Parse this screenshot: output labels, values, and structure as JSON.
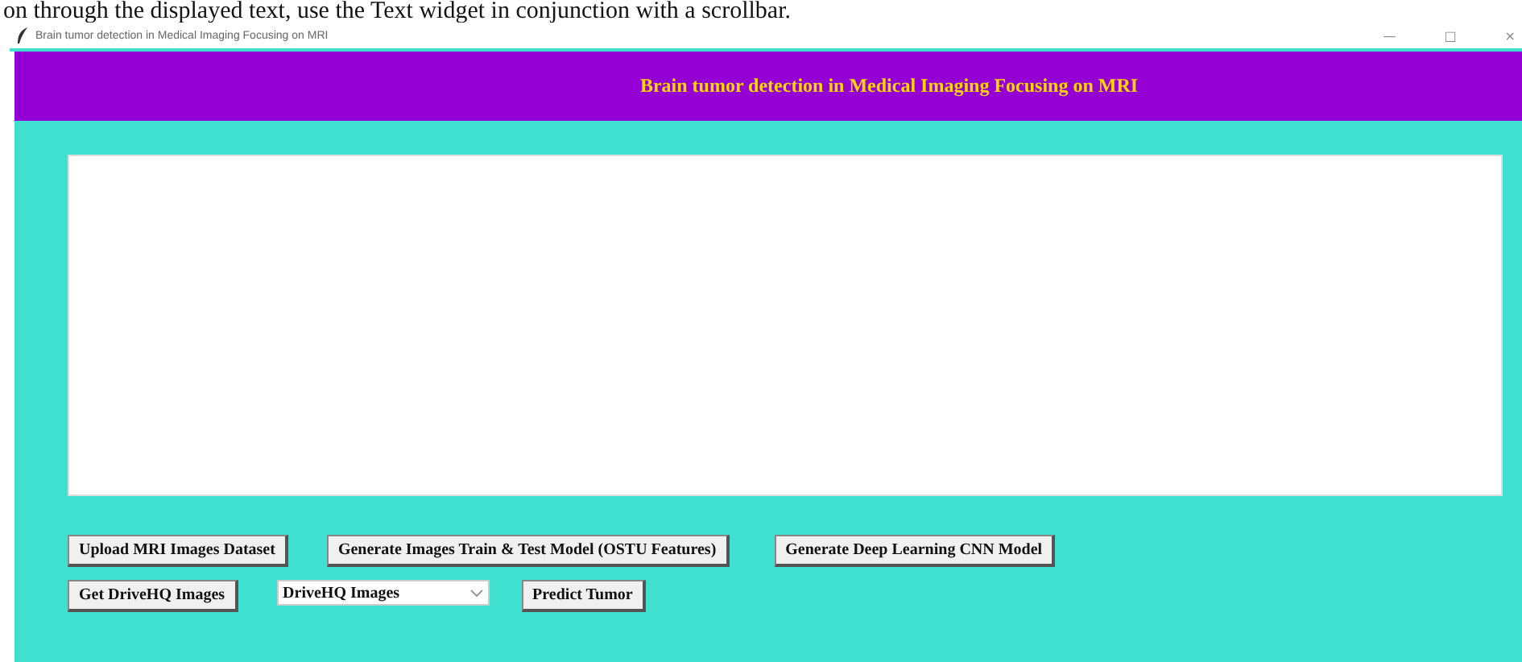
{
  "document_text": "on through the displayed text, use the Text widget in conjunction with a scrollbar.",
  "window": {
    "title": "Brain tumor detection in Medical Imaging Focusing on MRI",
    "controls": [
      "—",
      "□",
      "×"
    ]
  },
  "header": {
    "title": "Brain tumor detection in Medical Imaging Focusing on MRI"
  },
  "button_rows": [
    {
      "items": [
        {
          "kind": "button",
          "label": "Upload MRI Images Dataset"
        },
        {
          "kind": "button",
          "label": "Generate Images Train & Test Model (OSTU Features)"
        },
        {
          "kind": "button",
          "label": "Generate Deep Learning CNN Model"
        }
      ]
    },
    {
      "items": [
        {
          "kind": "button",
          "label": "Get DriveHQ Images"
        },
        {
          "kind": "dropdown",
          "label": "DriveHQ Images"
        },
        {
          "kind": "button",
          "label": "Predict Tumor"
        }
      ]
    }
  ]
}
